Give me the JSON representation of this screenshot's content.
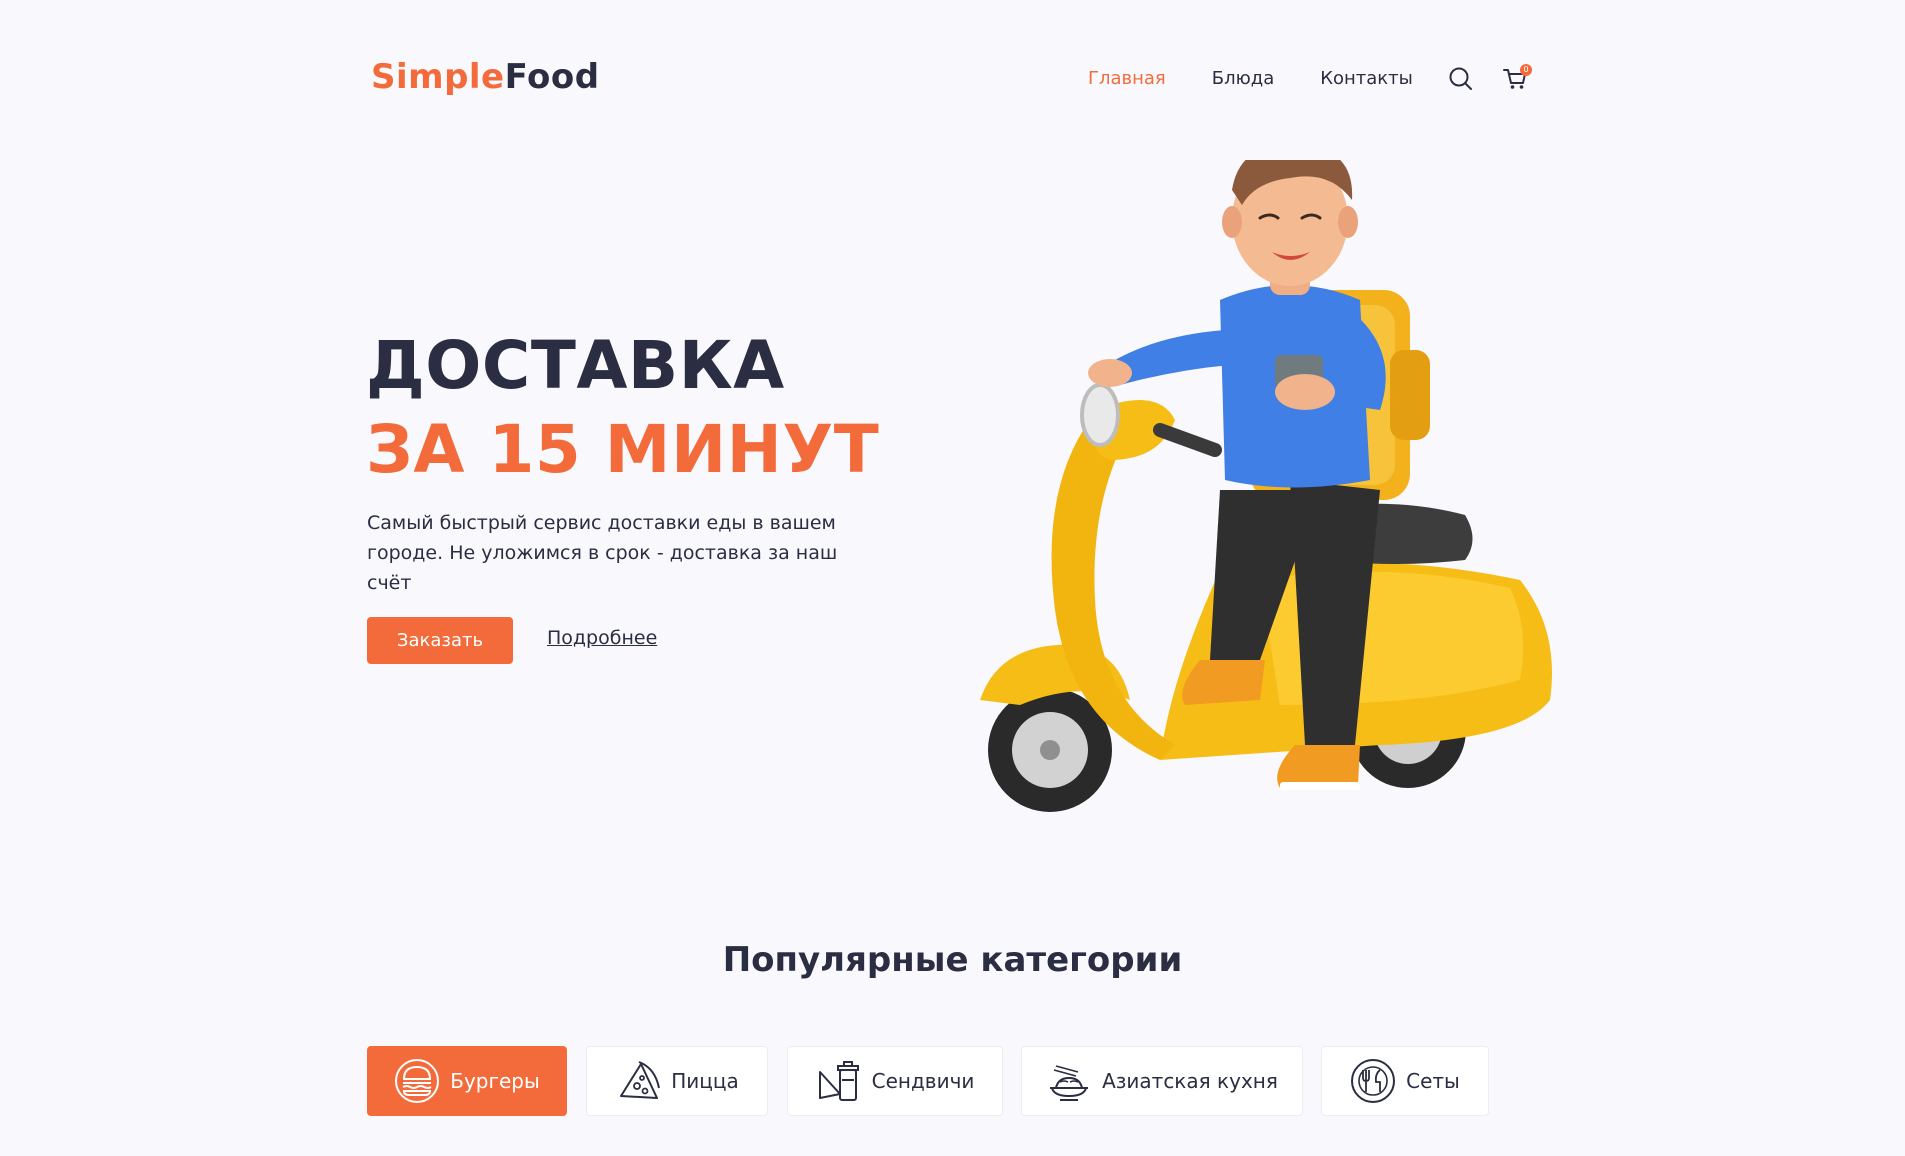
{
  "header": {
    "logo_part1": "Simple",
    "logo_part2": "Food",
    "nav": [
      "Главная",
      "Блюда",
      "Контакты"
    ],
    "cart_count": "0"
  },
  "hero": {
    "title_line1": "ДОСТАВКА",
    "title_line2": "ЗА 15 МИНУТ",
    "text": "Самый быстрый сервис доставки еды в вашем городе. Не уложимся в срок - доставка за наш счёт",
    "order_label": "Заказать",
    "more_label": "Подробнее"
  },
  "categories": {
    "title": "Популярные категории",
    "items": [
      {
        "label": "Бургеры",
        "icon": "burger-icon"
      },
      {
        "label": "Пицца",
        "icon": "pizza-icon"
      },
      {
        "label": "Сендвичи",
        "icon": "sandwich-icon"
      },
      {
        "label": "Азиатская кухня",
        "icon": "asian-food-icon"
      },
      {
        "label": "Сеты",
        "icon": "sets-icon"
      }
    ]
  },
  "colors": {
    "accent": "#f36b3b",
    "dark": "#2b2d42",
    "background": "#f9f9fd"
  }
}
